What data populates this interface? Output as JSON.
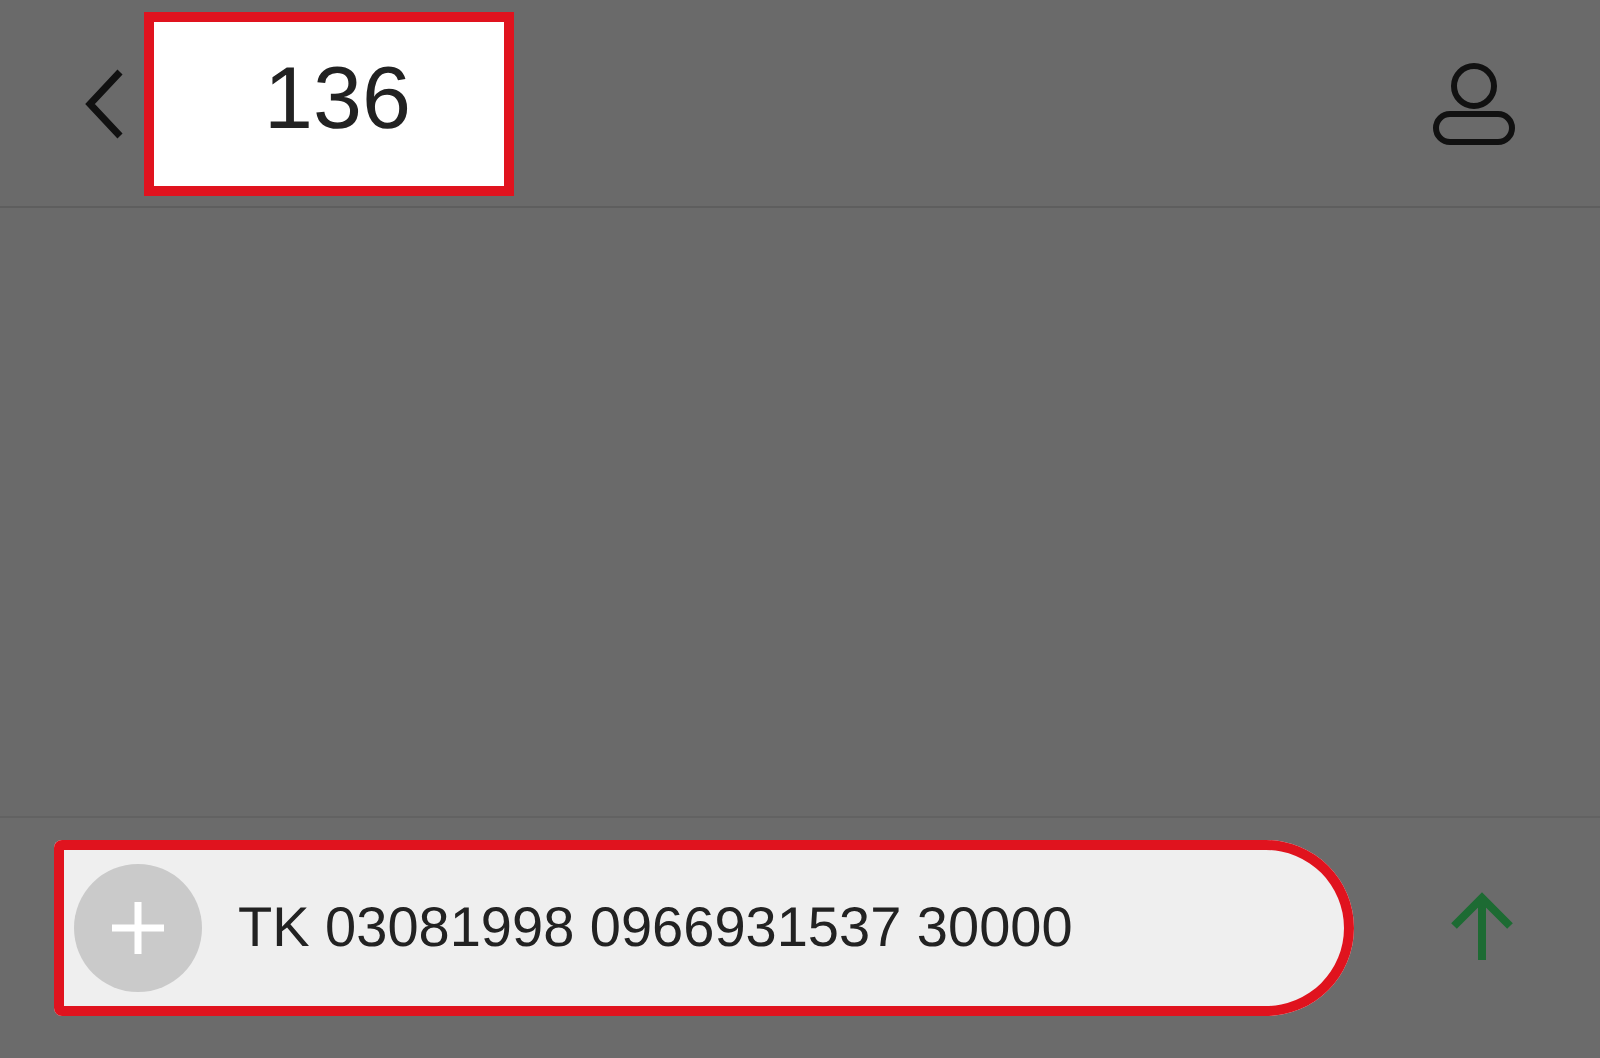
{
  "header": {
    "title": "136",
    "highlighted": true
  },
  "composer": {
    "value": "TK 03081998 0966931537 30000",
    "highlighted": true
  }
}
